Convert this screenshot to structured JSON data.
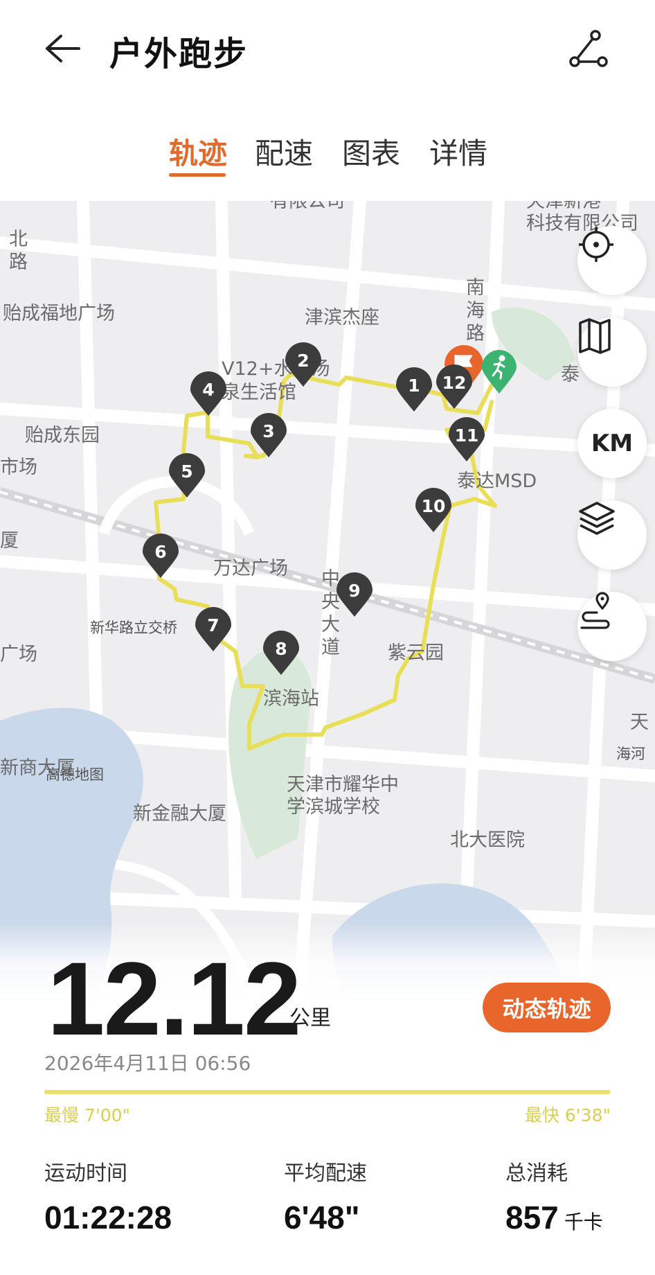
{
  "header": {
    "title": "户外跑步",
    "back_icon": "arrow-left-icon",
    "share_icon": "route-share-icon"
  },
  "tabs": [
    {
      "label": "轨迹",
      "active": true
    },
    {
      "label": "配速",
      "active": false
    },
    {
      "label": "图表",
      "active": false
    },
    {
      "label": "详情",
      "active": false
    }
  ],
  "map": {
    "labels": {
      "top_company": "有限公司",
      "top_right_company_1": "天津新港",
      "top_right_company_2": "科技有限公司",
      "north_road": "北路",
      "yicheng_fudi": "贻成福地广场",
      "jinbin_jiezuo": "津滨杰座",
      "nanhai_road": "南海路",
      "v12_1": "V12+水裹汤",
      "v12_2": "泉生活馆",
      "tai": "泰",
      "yicheng_dongyuan": "贻成东园",
      "market": "市场",
      "taida_msd": "泰达MSD",
      "xia": "厦",
      "wanda": "万达广场",
      "zhongyang": "中央大道",
      "xinhua_bridge": "新华路立交桥",
      "guangchang": "广场",
      "ziyunyuan": "紫云园",
      "binhai_station": "滨海站",
      "tian": "天",
      "haihe": "海河",
      "xinshang": "新商大厦",
      "amap": "高德地图",
      "school_1": "天津市耀华中",
      "school_2": "学滨城学校",
      "xinjinrong": "新金融大厦",
      "beidayiyuan": "北大医院",
      "route_color": "#e8de58",
      "start_color": "#e8662c",
      "end_color": "#3cb371"
    },
    "pins": [
      "1",
      "2",
      "3",
      "4",
      "5",
      "6",
      "7",
      "8",
      "9",
      "10",
      "11",
      "12"
    ],
    "controls": {
      "locate_icon": "locate-crosshair-icon",
      "map_icon": "map-fold-icon",
      "km_label": "KM",
      "layers_icon": "layers-icon",
      "route_icon": "route-pin-icon"
    },
    "start_icon": "flag-icon",
    "end_icon": "runner-icon"
  },
  "summary": {
    "distance": "12.12",
    "unit": "公里",
    "replay_label": "动态轨迹",
    "datetime": "2026年4月11日 06:56",
    "slowest": "最慢 7'00\"",
    "fastest": "最快 6'38\""
  },
  "stats": [
    {
      "label": "运动时间",
      "value": "01:22:28",
      "unit": ""
    },
    {
      "label": "平均配速",
      "value": "6'48\"",
      "unit": ""
    },
    {
      "label": "总消耗",
      "value": "857",
      "unit": "千卡"
    }
  ]
}
